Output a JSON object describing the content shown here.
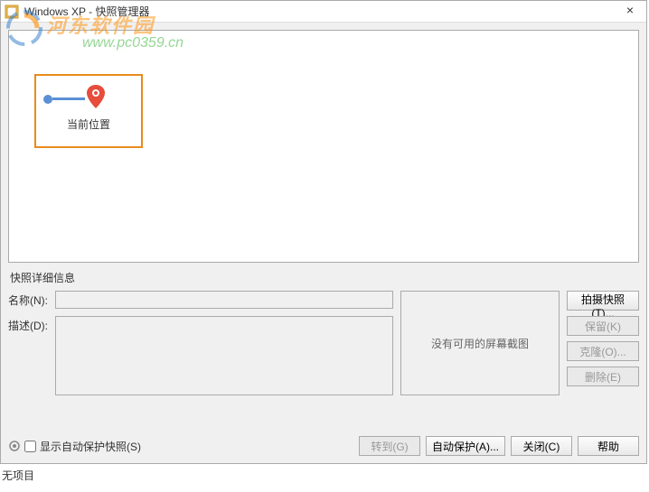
{
  "titlebar": {
    "title": "Windows XP - 快照管理器",
    "close": "×"
  },
  "watermark": {
    "text": "河东软件园",
    "url": "www.pc0359.cn"
  },
  "tree": {
    "current_location": "当前位置"
  },
  "details": {
    "section_title": "快照详细信息",
    "name_label": "名称(N):",
    "name_value": "",
    "desc_label": "描述(D):",
    "desc_value": "",
    "screenshot_placeholder": "没有可用的屏幕截图"
  },
  "buttons": {
    "take_snapshot": "拍摄快照(T)...",
    "keep": "保留(K)",
    "clone": "克隆(O)...",
    "delete": "删除(E)",
    "goto": "转到(G)",
    "auto_protect": "自动保护(A)...",
    "close": "关闭(C)",
    "help": "帮助"
  },
  "bottom": {
    "show_auto_protect": "显示自动保护快照(S)"
  },
  "status": {
    "no_item": "无项目"
  }
}
